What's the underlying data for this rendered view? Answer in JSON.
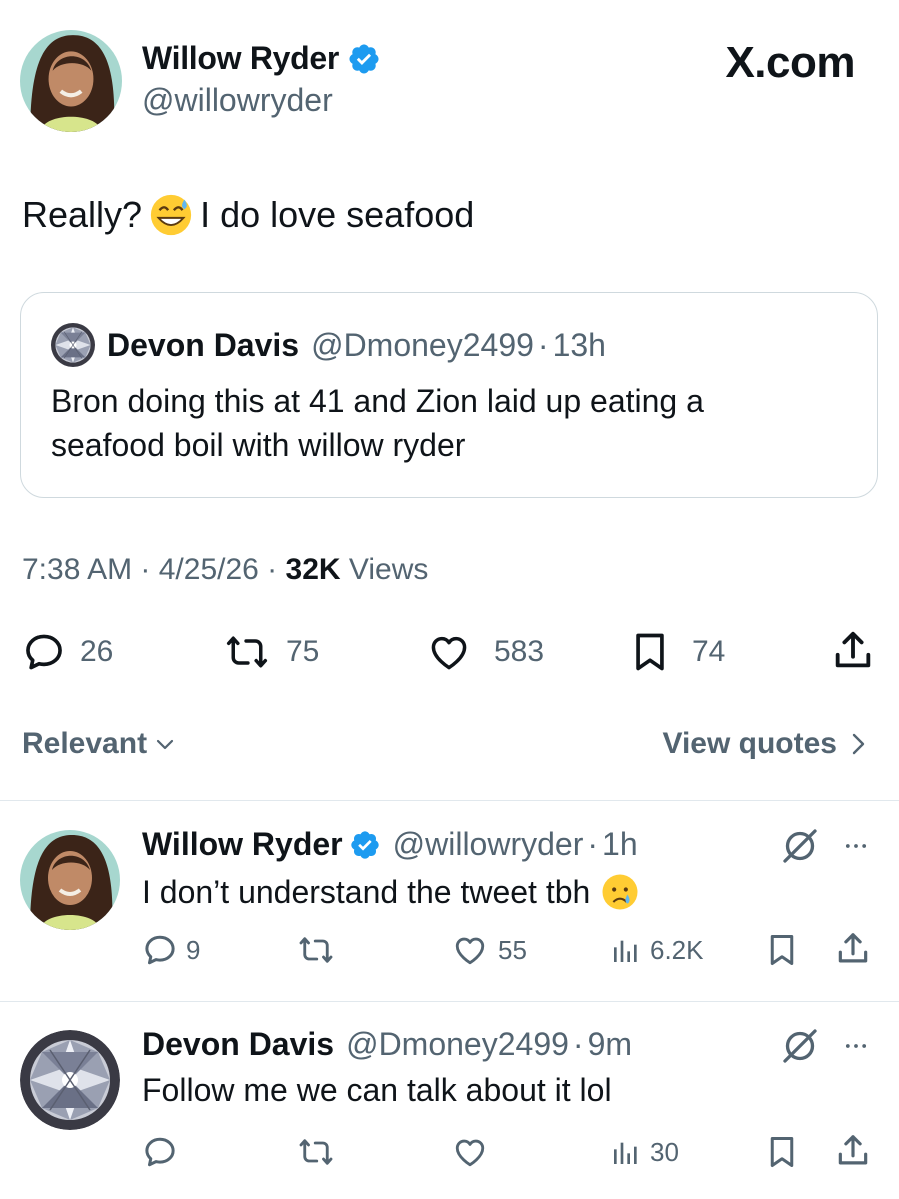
{
  "author": {
    "name": "Willow Ryder",
    "handle": "@willowryder"
  },
  "brand": "X.com",
  "tweet": {
    "text_before": "Really?",
    "text_after": "I do love seafood"
  },
  "quoted": {
    "name": "Devon Davis",
    "handle": "@Dmoney2499",
    "sep": "·",
    "time": "13h",
    "text": "Bron doing this at 41 and Zion laid up eating a seafood boil with willow ryder"
  },
  "meta": {
    "time": "7:38 AM",
    "sep1": " · ",
    "date": "4/25/26",
    "sep2": " · ",
    "views_count": "32K",
    "views_label": " Views"
  },
  "actions": {
    "replies": "26",
    "reposts": "75",
    "likes": "583",
    "bookmarks": "74"
  },
  "sort": {
    "label": "Relevant",
    "view_quotes": "View quotes"
  },
  "replies": [
    {
      "name": "Willow Ryder",
      "handle": "@willowryder",
      "sep": "·",
      "time": "1h",
      "text": "I don’t understand the tweet tbh",
      "replies": "9",
      "reposts": "",
      "likes": "55",
      "views": "6.2K"
    },
    {
      "name": "Devon Davis",
      "handle": "@Dmoney2499",
      "sep": "·",
      "time": "9m",
      "text": "Follow me we can talk about it lol",
      "replies": "",
      "reposts": "",
      "likes": "",
      "views": "30"
    }
  ],
  "colors": {
    "verified": "#1d9bf0",
    "secondary": "#536471",
    "text": "#0f1419",
    "border": "#cfd9de"
  }
}
